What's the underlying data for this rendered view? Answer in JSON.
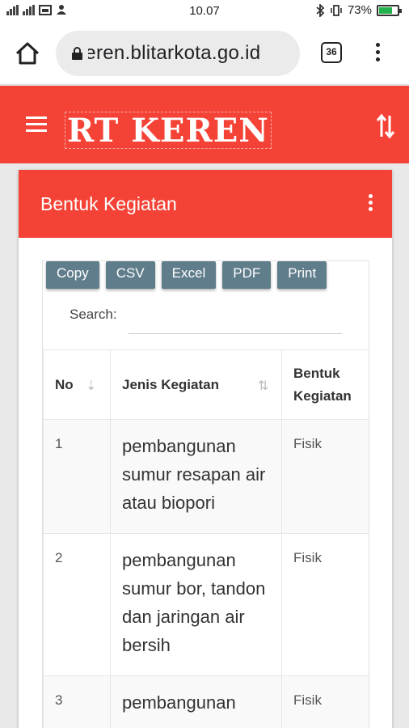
{
  "status_bar": {
    "left_icons": [
      "signal-bars-icon",
      "signal-bars-icon",
      "gallery-icon",
      "notification-icon"
    ],
    "time": "10.07",
    "right_icons": [
      "bluetooth-icon",
      "vibrate-icon"
    ],
    "battery_percent": "73%",
    "battery_level": 0.73
  },
  "browser": {
    "url": "keren.blitarkota.go.id",
    "tab_count": "36"
  },
  "site": {
    "logo_text": "RT KEREN",
    "accent_color": "#f44336"
  },
  "card": {
    "title": "Bentuk Kegiatan",
    "buttons": [
      "Copy",
      "CSV",
      "Excel",
      "PDF",
      "Print"
    ],
    "search_label": "Search:",
    "button_color": "#607d8b"
  },
  "table": {
    "columns": [
      "No",
      "Jenis Kegiatan",
      "Bentuk Kegiatan"
    ],
    "rows": [
      {
        "no": "1",
        "jenis": "pembangunan sumur resapan air atau biopori",
        "bentuk": "Fisik"
      },
      {
        "no": "2",
        "jenis": "pembangunan sumur bor, tandon dan jaringan air bersih",
        "bentuk": "Fisik"
      },
      {
        "no": "3",
        "jenis": "pembangunan",
        "bentuk": "Fisik"
      }
    ]
  }
}
